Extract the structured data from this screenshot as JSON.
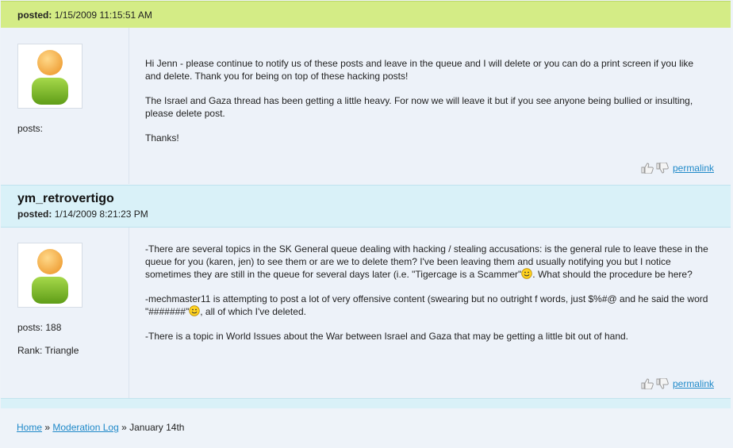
{
  "post1": {
    "posted_label": "posted:",
    "posted_value": "1/15/2009 11:15:51 AM",
    "posts_label": "posts:",
    "paragraphs": [
      "Hi Jenn - please continue to notify us of these posts and leave in the queue and I will delete or you can do a print screen if you like and delete. Thank you for being on top of these hacking posts!",
      "The Israel and Gaza thread has been getting a little heavy. For now we will leave it but if you see anyone being bullied or insulting, please delete post.",
      "Thanks!"
    ],
    "permalink": "permalink"
  },
  "post2": {
    "username": "ym_retrovertigo",
    "posted_label": "posted:",
    "posted_value": "1/14/2009 8:21:23 PM",
    "posts_label": "posts: 188",
    "rank_label": "Rank: Triangle",
    "p1_a": "-There are several topics in the SK General queue dealing with hacking / stealing accusations: is the general rule to leave these in the queue for you (karen, jen) to see them or are we to delete them? I've been leaving them and usually notifying you but I notice sometimes they are still in the queue for several days later (i.e. \"Tigercage is a Scammer\"",
    "p1_b": ". What should the procedure be here?",
    "p2_a": "-mechmaster11 is attempting to post a lot of very offensive content (swearing but no outright f words, just $%#@ and he said the word \"#######\"",
    "p2_b": ", all of which I've deleted.",
    "p3": "-There is a topic in World Issues about the War between Israel and Gaza that may be getting a little bit out of hand.",
    "permalink": "permalink"
  },
  "breadcrumb": {
    "home": "Home",
    "sep1": " » ",
    "moderation_log": "Moderation Log",
    "sep2": " » ",
    "current": "January 14th"
  },
  "colors": {
    "header_green": "#d4ec86",
    "header_blue": "#d9f1f8",
    "link": "#1f89c9"
  },
  "icons": [
    "default-avatar-icon",
    "thumbs-up-icon",
    "thumbs-down-icon",
    "smiley-icon"
  ]
}
